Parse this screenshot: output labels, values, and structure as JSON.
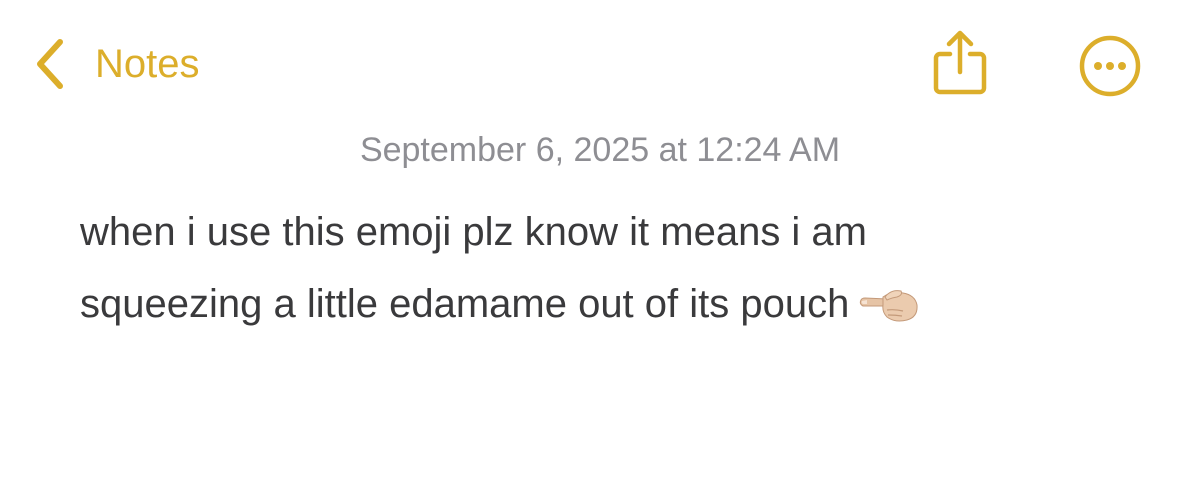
{
  "colors": {
    "accent": "#DCAE2B",
    "date_text": "#8E8E93",
    "body_text": "#3A3A3C",
    "background": "#FFFFFF"
  },
  "nav": {
    "back_label": "Notes",
    "back_icon": "chevron-left-icon",
    "share_icon": "share-icon",
    "more_icon": "ellipsis-circle-icon"
  },
  "note": {
    "date": "September 6, 2025 at 12:24 AM",
    "line_1": "when i use this emoji plz know it means i am",
    "line_2": "squeezing a little edamame out of its pouch",
    "emoji_icon": "leftwards-pointing-hand-emoji"
  }
}
